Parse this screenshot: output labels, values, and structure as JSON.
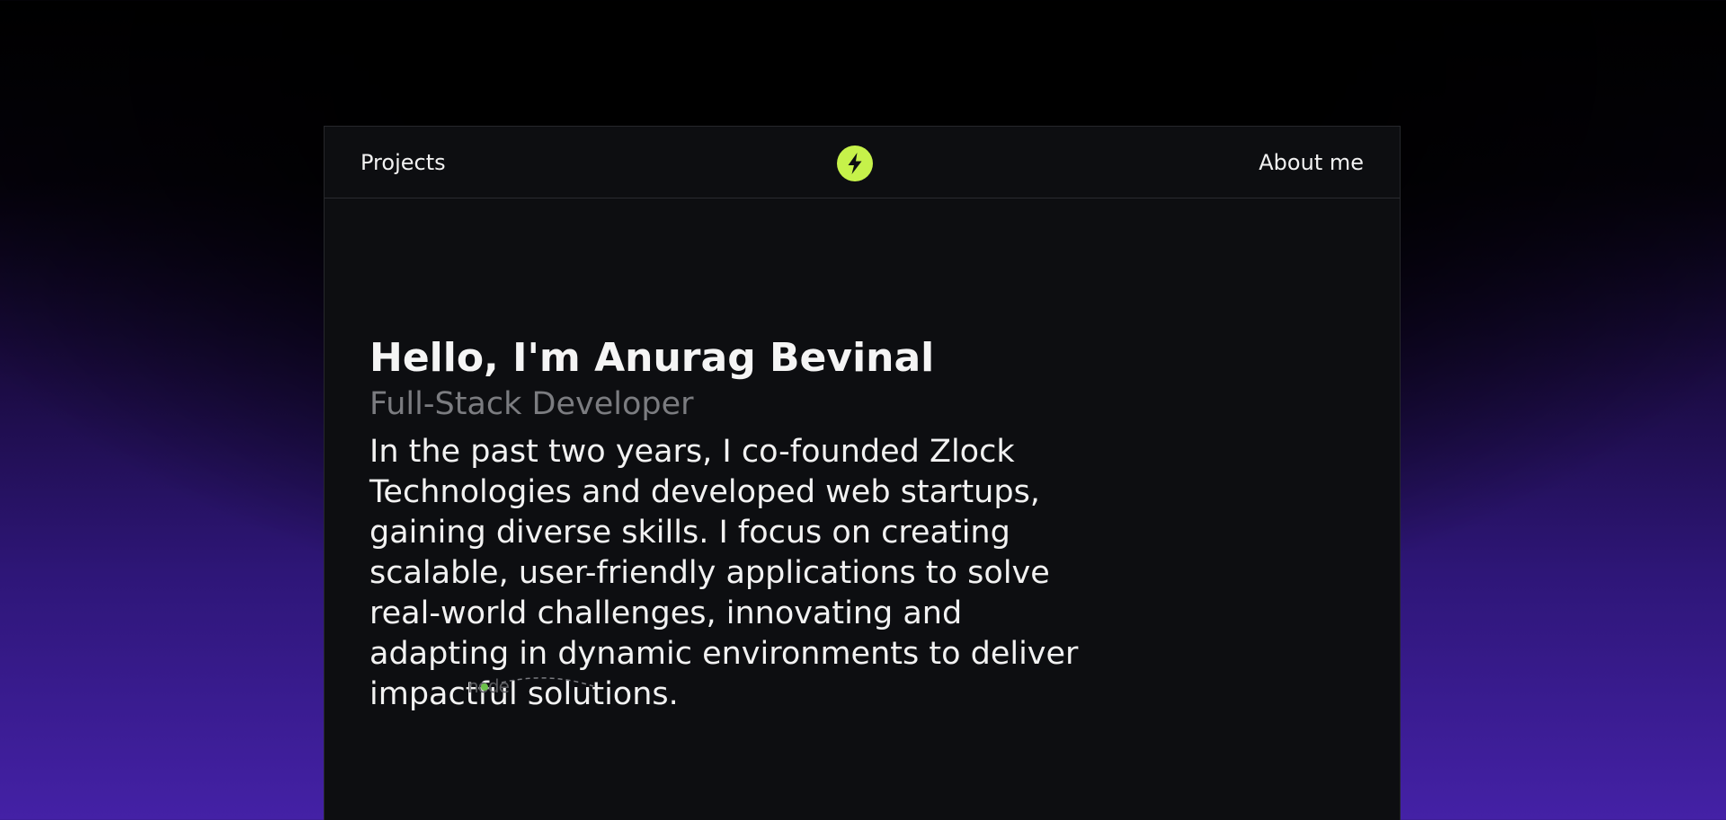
{
  "nav": {
    "left_link": "Projects",
    "right_link": "About me",
    "logo_icon": "lightning-bolt-icon"
  },
  "hero": {
    "title": "Hello, I'm Anurag Bevinal",
    "subtitle": "Full-Stack Developer",
    "description": "In the past two years, I co-founded Zlock Technologies and developed web startups, gaining diverse skills. I focus on creating scalable, user-friendly applications to solve real-world challenges, innovating and adapting in dynamic environments to deliver impactful solutions."
  },
  "tech": {
    "node_label": "node"
  },
  "colors": {
    "accent": "#c6f24a",
    "card_background": "#0d0e11",
    "page_gradient_bottom": "#4421a6",
    "subtitle": "#7b7c80",
    "node_green": "#6cc24a"
  }
}
